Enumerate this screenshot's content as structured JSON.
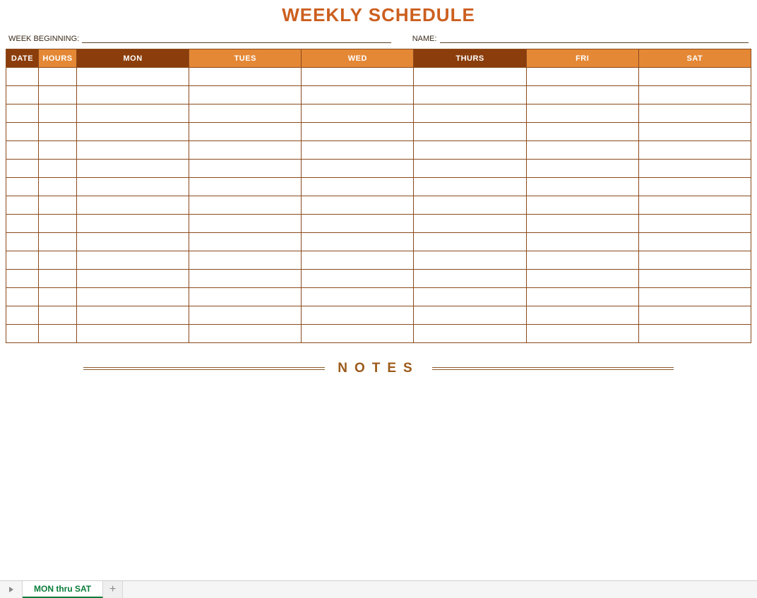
{
  "title": "WEEKLY SCHEDULE",
  "meta": {
    "week_beginning_label": "WEEK BEGINNING:",
    "week_beginning_value": "",
    "name_label": "NAME:",
    "name_value": ""
  },
  "table": {
    "headers": [
      "DATE",
      "HOURS",
      "MON",
      "TUES",
      "WED",
      "THURS",
      "FRI",
      "SAT"
    ],
    "row_count": 15,
    "rows": [
      [
        "",
        "",
        "",
        "",
        "",
        "",
        "",
        ""
      ],
      [
        "",
        "",
        "",
        "",
        "",
        "",
        "",
        ""
      ],
      [
        "",
        "",
        "",
        "",
        "",
        "",
        "",
        ""
      ],
      [
        "",
        "",
        "",
        "",
        "",
        "",
        "",
        ""
      ],
      [
        "",
        "",
        "",
        "",
        "",
        "",
        "",
        ""
      ],
      [
        "",
        "",
        "",
        "",
        "",
        "",
        "",
        ""
      ],
      [
        "",
        "",
        "",
        "",
        "",
        "",
        "",
        ""
      ],
      [
        "",
        "",
        "",
        "",
        "",
        "",
        "",
        ""
      ],
      [
        "",
        "",
        "",
        "",
        "",
        "",
        "",
        ""
      ],
      [
        "",
        "",
        "",
        "",
        "",
        "",
        "",
        ""
      ],
      [
        "",
        "",
        "",
        "",
        "",
        "",
        "",
        ""
      ],
      [
        "",
        "",
        "",
        "",
        "",
        "",
        "",
        ""
      ],
      [
        "",
        "",
        "",
        "",
        "",
        "",
        "",
        ""
      ],
      [
        "",
        "",
        "",
        "",
        "",
        "",
        "",
        ""
      ],
      [
        "",
        "",
        "",
        "",
        "",
        "",
        "",
        ""
      ]
    ]
  },
  "notes_label": "NOTES",
  "tabs": {
    "active_sheet": "MON thru SAT"
  },
  "colors": {
    "title": "#CC5F1E",
    "header_dark": "#8B3E0C",
    "header_light": "#E48836",
    "border": "#8a4a1c",
    "notes_text": "#9C5A1A",
    "tab_active_text": "#0a7d3a"
  }
}
